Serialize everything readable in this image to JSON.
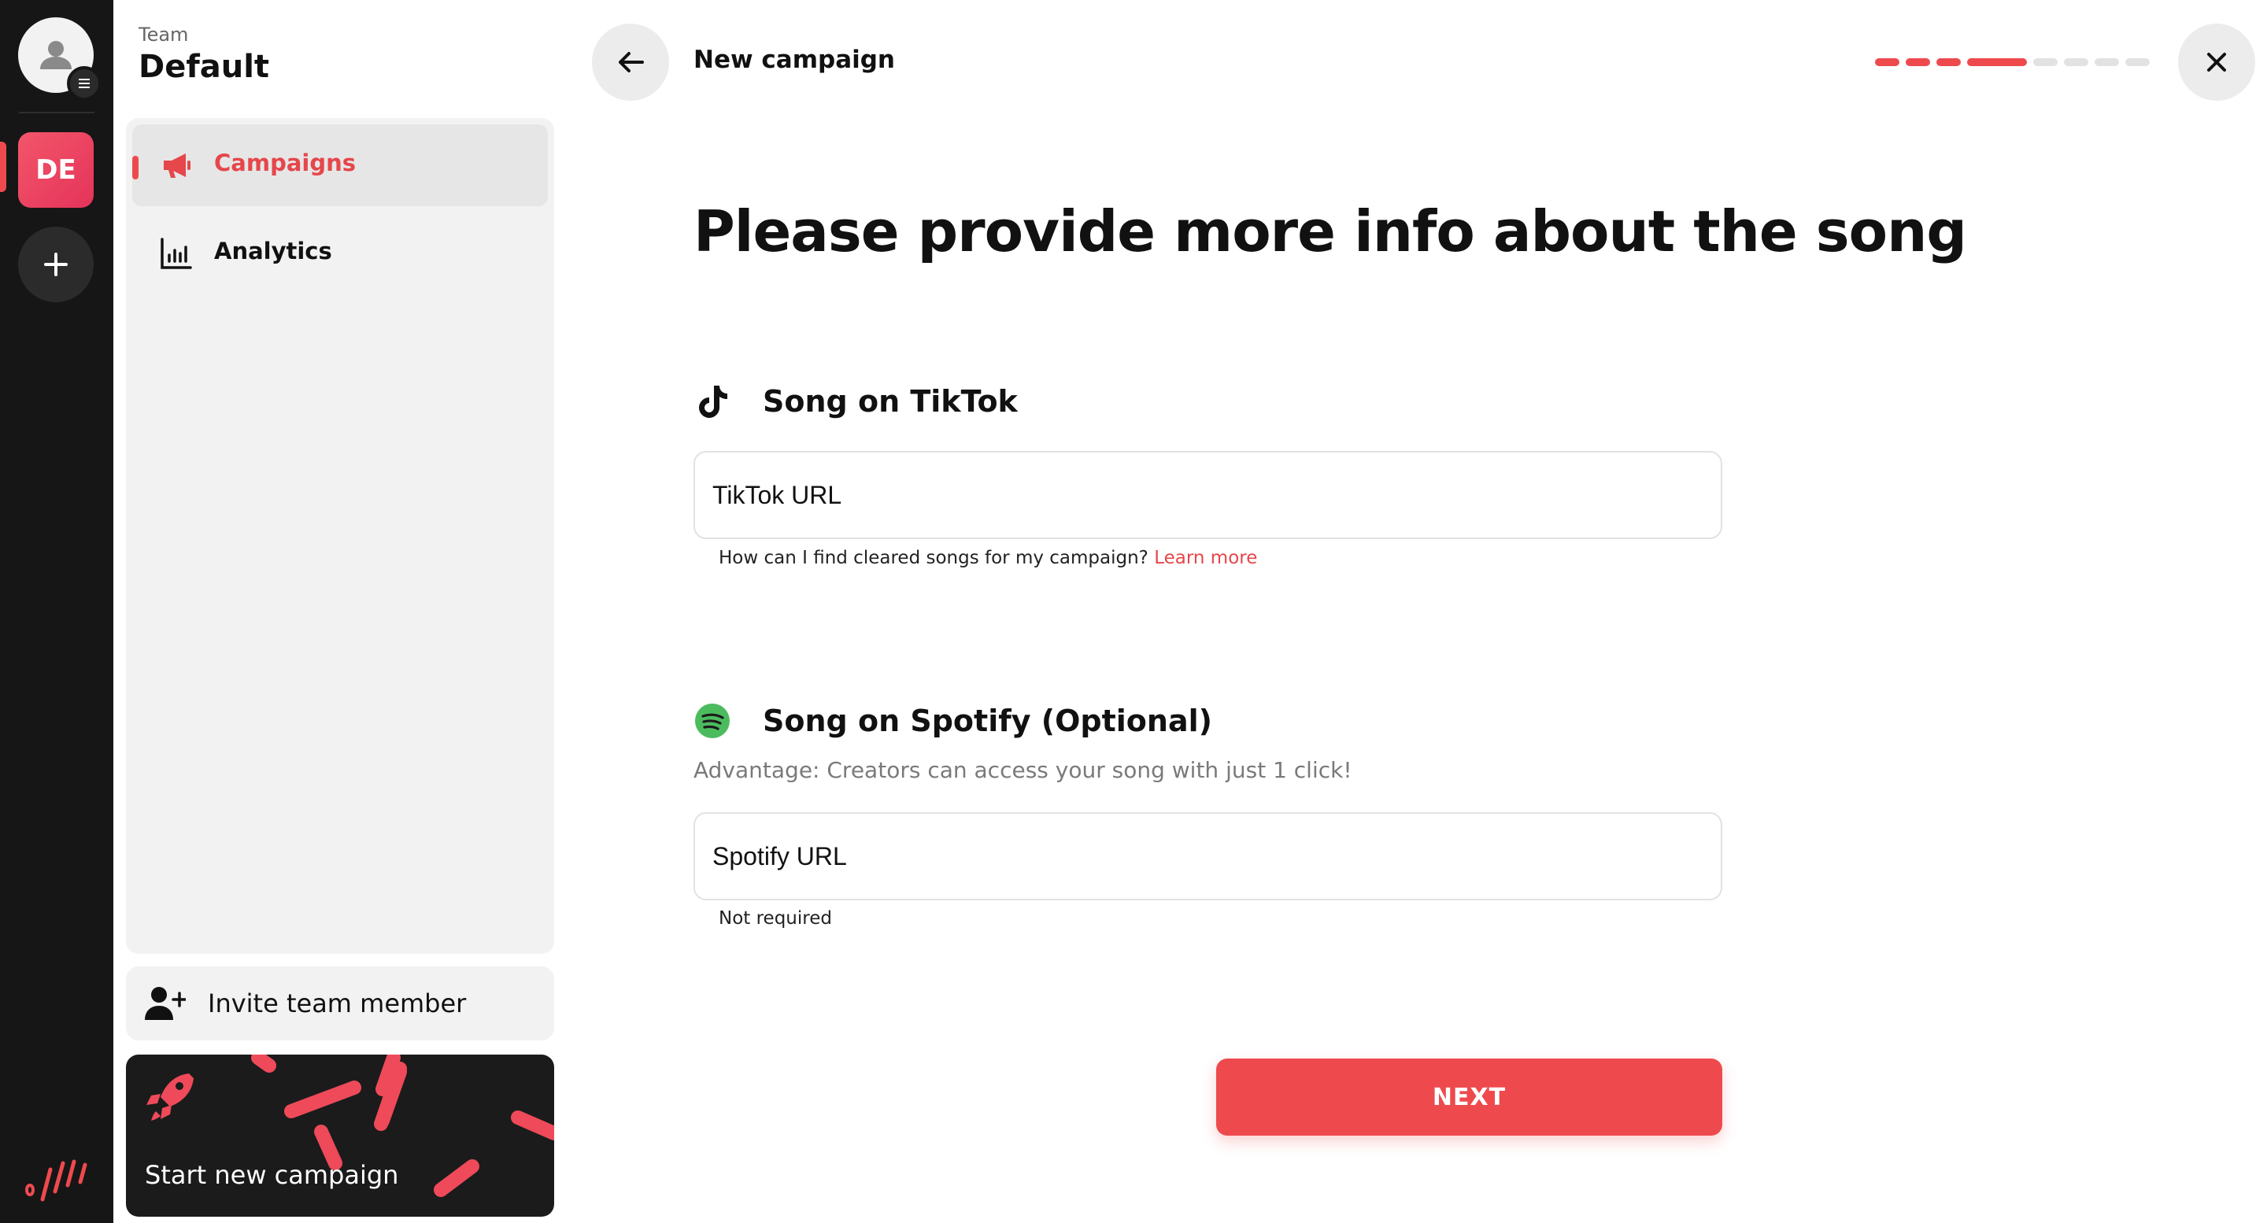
{
  "rail": {
    "team_initials": "DE",
    "accent": "#ee4a4e"
  },
  "sidebar": {
    "team_label": "Team",
    "team_name": "Default",
    "items": [
      {
        "label": "Campaigns",
        "icon": "megaphone-icon",
        "active": true
      },
      {
        "label": "Analytics",
        "icon": "bar-chart-icon",
        "active": false
      }
    ],
    "invite_label": "Invite team member",
    "start_label": "Start new campaign"
  },
  "header": {
    "title": "New campaign",
    "progress": {
      "completed_steps": 4,
      "total_steps": 8
    }
  },
  "main": {
    "heading": "Please provide more info about the song",
    "tiktok": {
      "title": "Song on TikTok",
      "placeholder": "TikTok URL",
      "hint": "How can I find cleared songs for my campaign?",
      "hint_link": "Learn more"
    },
    "spotify": {
      "title": "Song on Spotify (Optional)",
      "subtitle": "Advantage: Creators can access your song with just 1 click!",
      "placeholder": "Spotify URL",
      "hint": "Not required"
    },
    "next_label": "NEXT"
  }
}
